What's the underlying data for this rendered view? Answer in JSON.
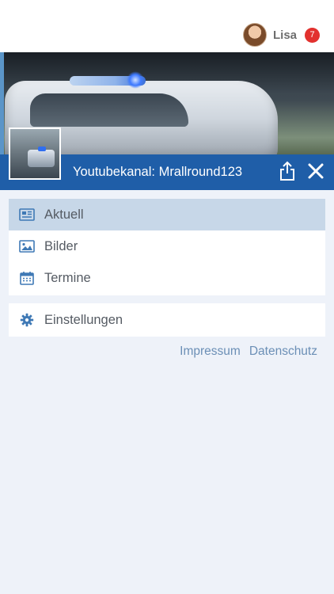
{
  "header": {
    "user_name": "Lisa",
    "notification_count": "7"
  },
  "hero": {
    "caption": "Youtubekanal: Mrallround123"
  },
  "menu": {
    "main_items": [
      {
        "label": "Aktuell",
        "icon": "news-icon",
        "active": true
      },
      {
        "label": "Bilder",
        "icon": "image-icon",
        "active": false
      },
      {
        "label": "Termine",
        "icon": "calendar-icon",
        "active": false
      }
    ],
    "settings_item": {
      "label": "Einstellungen",
      "icon": "gear-icon"
    }
  },
  "footer": {
    "impressum": "Impressum",
    "datenschutz": "Datenschutz"
  },
  "colors": {
    "brand_blue": "#1f5ea8",
    "active_row": "#c7d7e8",
    "badge_red": "#e2312e",
    "link_blue": "#6b8fb6",
    "background": "#eef2f9"
  }
}
